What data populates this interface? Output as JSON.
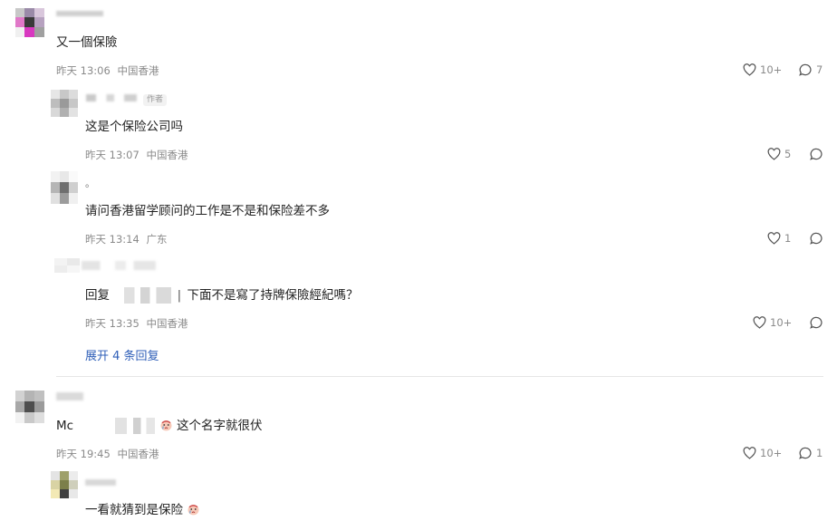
{
  "comments": [
    {
      "text": "又一個保險",
      "time": "昨天 13:06",
      "location": "中国香港",
      "likes": "10+",
      "replies": "7",
      "replies_list": [
        {
          "badge": "作者",
          "text": "这是个保险公司吗",
          "time": "昨天 13:07",
          "location": "中国香港",
          "likes": "5"
        },
        {
          "name_fragment": "。",
          "text": "请问香港留学顾问的工作是不是和保险差不多",
          "time": "昨天 13:14",
          "location": "广东",
          "likes": "1"
        },
        {
          "text_prefix": "回复",
          "text_suffix": "下面不是寫了持牌保險經紀嗎？",
          "time": "昨天 13:35",
          "location": "中国香港",
          "likes": "10+"
        }
      ],
      "expand_label": "展开 4 条回复"
    },
    {
      "text_prefix": "Mc",
      "text_suffix": "这个名字就很伏",
      "time": "昨天 19:45",
      "location": "中国香港",
      "likes": "10+",
      "replies": "1",
      "replies_list": [
        {
          "text": "一看就猜到是保险"
        }
      ]
    }
  ],
  "colors": {
    "link": "#2f5fb8",
    "meta": "#8a8a8a",
    "divider": "#e6e6e6"
  },
  "icons": [
    "heart-icon",
    "comment-bubble-icon",
    "crying-face-emoji"
  ]
}
